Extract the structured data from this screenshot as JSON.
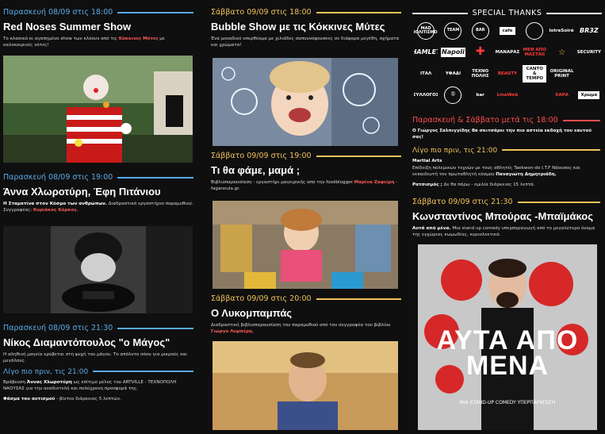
{
  "col1": {
    "ev1": {
      "date": "Παρασκευή 08/09 στις 18:00",
      "title": "Red Noses Summer Show",
      "desc_pre": "Το κλασικό κι αγαπημένο show των κλόουν από τις ",
      "desc_bold": "Κόκκινες Μύτες",
      "desc_post": " με καλοκαιρινές νότες!"
    },
    "ev2": {
      "date": "Παρασκευή 08/09 στις 19:00",
      "title": "Άννα Χλωροτύρη, Έφη Πιτάνιου",
      "desc_bold": "Η Σταματίνα στον Κόσμο των ανθρώπων.",
      "desc_post": " Διαδραστικό εργαστήριο παραμυθιού.",
      "desc2_pre": "Συγγραφέας: ",
      "desc2_bold": "Κυριάκος Κόρκος."
    },
    "ev3": {
      "date": "Παρασκευή 08/09 στις 21:30",
      "title": "Νίκος Διαμαντόπουλος \"ο Μάγος\"",
      "desc": "Η αληθινή μαγεία κρύβεται στη ψυχή του μάγου. Το απόλυτο σόου για μικρούς και μεγάλους.",
      "sub": "Λίγο πιο πριν, τις 21:00",
      "sub_desc_pre": "Βράβευση ",
      "sub_desc_bold": "Άννας Χλωροτύρη",
      "sub_desc_post": " ως επίτιμο μέλος του ARTVILLE - ΤΕΧΝΟΠΟΛΗ ΝΑΟΥΣΑΣ για την αναδιοτελή και πολύχρονη προσφορά της.",
      "sub_desc2_bold": "Φάσμα του αυτισμού",
      "sub_desc2_post": " - βίντεο διάρκειας 5 λεπτών."
    }
  },
  "col2": {
    "ev1": {
      "date": "Σάββατο 09/09 στις 18:00",
      "title": "Bubble Show με τις Κόκκινες Μύτες",
      "desc": "Ένα μοναδικό υπερθέαμα με χιλιάδες σαπουνόφουσκες σε διάφορα μεγέθη, σχήματα και χρώματα!"
    },
    "ev2": {
      "date": "Σάββατο 09/09 στις 19:00",
      "title": "Τι θα φάμε, μαμά ;",
      "desc_pre": "Βιβλιοπαρουσίαση - εργαστήρι μαγειρικής από την foodblogger ",
      "desc_bold": "Μαρίνα Ζαφείρη",
      "desc_post": " - faganoula.gr."
    },
    "ev3": {
      "date": "Σάββατο 09/09 στις 20:00",
      "title": "Ο Λυκομπαμπάς",
      "desc_pre": "Διαδραστική βιβλιοπαρουσίαση του παραμυθιού από τον συγγραφέα του βιβλίου ",
      "desc_bold": "Γιώργο Λυμπέρη."
    }
  },
  "col3": {
    "thanks_title": "SPECIAL THANKS",
    "logos": [
      "MAD ΠΟΛΙΤΙΣΜΟΣ",
      "TEAM",
      "BAR",
      "cafe",
      "",
      "bar",
      "NotreSoirée",
      "BR3Z",
      "HAMLET",
      "Napoli",
      "✚",
      "ΜΑΝΑΡΑΣ",
      "ΜΕΘ ΑΠΟ ΜΑΣΤΑΙΙ",
      "☆",
      "SECURITY",
      "ΙΤΑΛ",
      "ΥΦΑΔΙ",
      "ΤΕΧΝΟ ΠΟΛΗΣ",
      "BEAUTY",
      "CANTO & TEMPO",
      "ORIGINAL PRINT",
      "ΣΥΛΛΟΓΟΣ",
      "Ⓢ",
      "LineWeb",
      "ΧΑΡΑ",
      "Χρώμα"
    ],
    "sat_date": "Παρασκευή & Σάββατο μετά τις 18:00",
    "sat_desc_pre": "Ο Γιώργος Σαλπιγγίδης ",
    "sat_desc_bold": "θα σκιτσάρει την πιο αστεία εκδοχή του εαυτού σας!",
    "sub": "Λίγο πιο πριν, τις 21:00",
    "arts_title": "Martial Arts",
    "arts_desc_pre": "Επίδειξη πολεμικών τεχνών με τους αθλητές Taekwon-do I.T.F Νάουσας και εκπαιδευτή τον πρωταθλητή κόσμου ",
    "arts_desc_bold": "Παναγιώτη Δημητριάδη.",
    "rac_bold": "Ρατσισμός ;",
    "rac_post": " Δε θα πάρω - ομιλία διάρκειας 15 λεπτά.",
    "ev2": {
      "date": "Σάββατο 09/09 στις 21:30",
      "title": "Κωνσταντίνος Μπούρας -Μπαϊμάκος",
      "desc_bold": "Αυτά από μένα.",
      "desc_post": " Μια stand up comedy υπερπαραγωγή από το μεγαλύτερο όνομα της εγχώριας κωμωδίας, κυριολεκτικά."
    },
    "poster_big": "ΑΥΤΑ ΑΠΟ ΜΕΝΑ",
    "poster_small": "MIA STAND-UP COMEDY ΥΠΕΡΠΑΡΑΓΩΓΗ"
  }
}
